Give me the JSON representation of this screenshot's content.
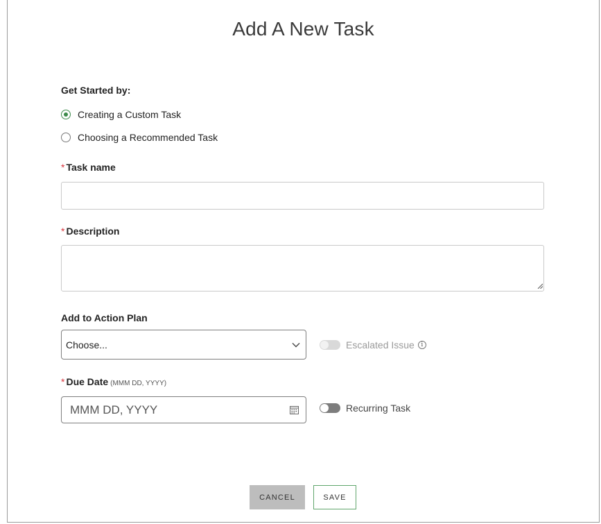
{
  "dialog": {
    "title": "Add A New Task"
  },
  "get_started": {
    "label": "Get Started by:",
    "options": [
      {
        "label": "Creating a Custom Task",
        "selected": true
      },
      {
        "label": "Choosing a Recommended Task",
        "selected": false
      }
    ]
  },
  "task_name": {
    "required_marker": "*",
    "label": "Task name",
    "value": "",
    "placeholder": ""
  },
  "description": {
    "required_marker": "*",
    "label": "Description",
    "value": "",
    "placeholder": ""
  },
  "action_plan": {
    "label": "Add to Action Plan",
    "selected": "Choose..."
  },
  "escalated_issue": {
    "label": "Escalated Issue",
    "enabled": false,
    "info_glyph": "i"
  },
  "due_date": {
    "required_marker": "*",
    "label": "Due Date",
    "format_hint": "(MMM DD, YYYY)",
    "placeholder": "MMM DD, YYYY"
  },
  "recurring_task": {
    "label": "Recurring Task",
    "on": false
  },
  "actions": {
    "cancel_label": "CANCEL",
    "save_label": "SAVE"
  },
  "colors": {
    "accent_green": "#3c8a4a",
    "required_red": "#d9363e",
    "cancel_bg": "#bdbdbd",
    "save_border": "#5fa56b"
  },
  "icons": {
    "select_caret": "chevron-down-icon",
    "date_picker": "calendar-icon",
    "info": "info-icon"
  }
}
